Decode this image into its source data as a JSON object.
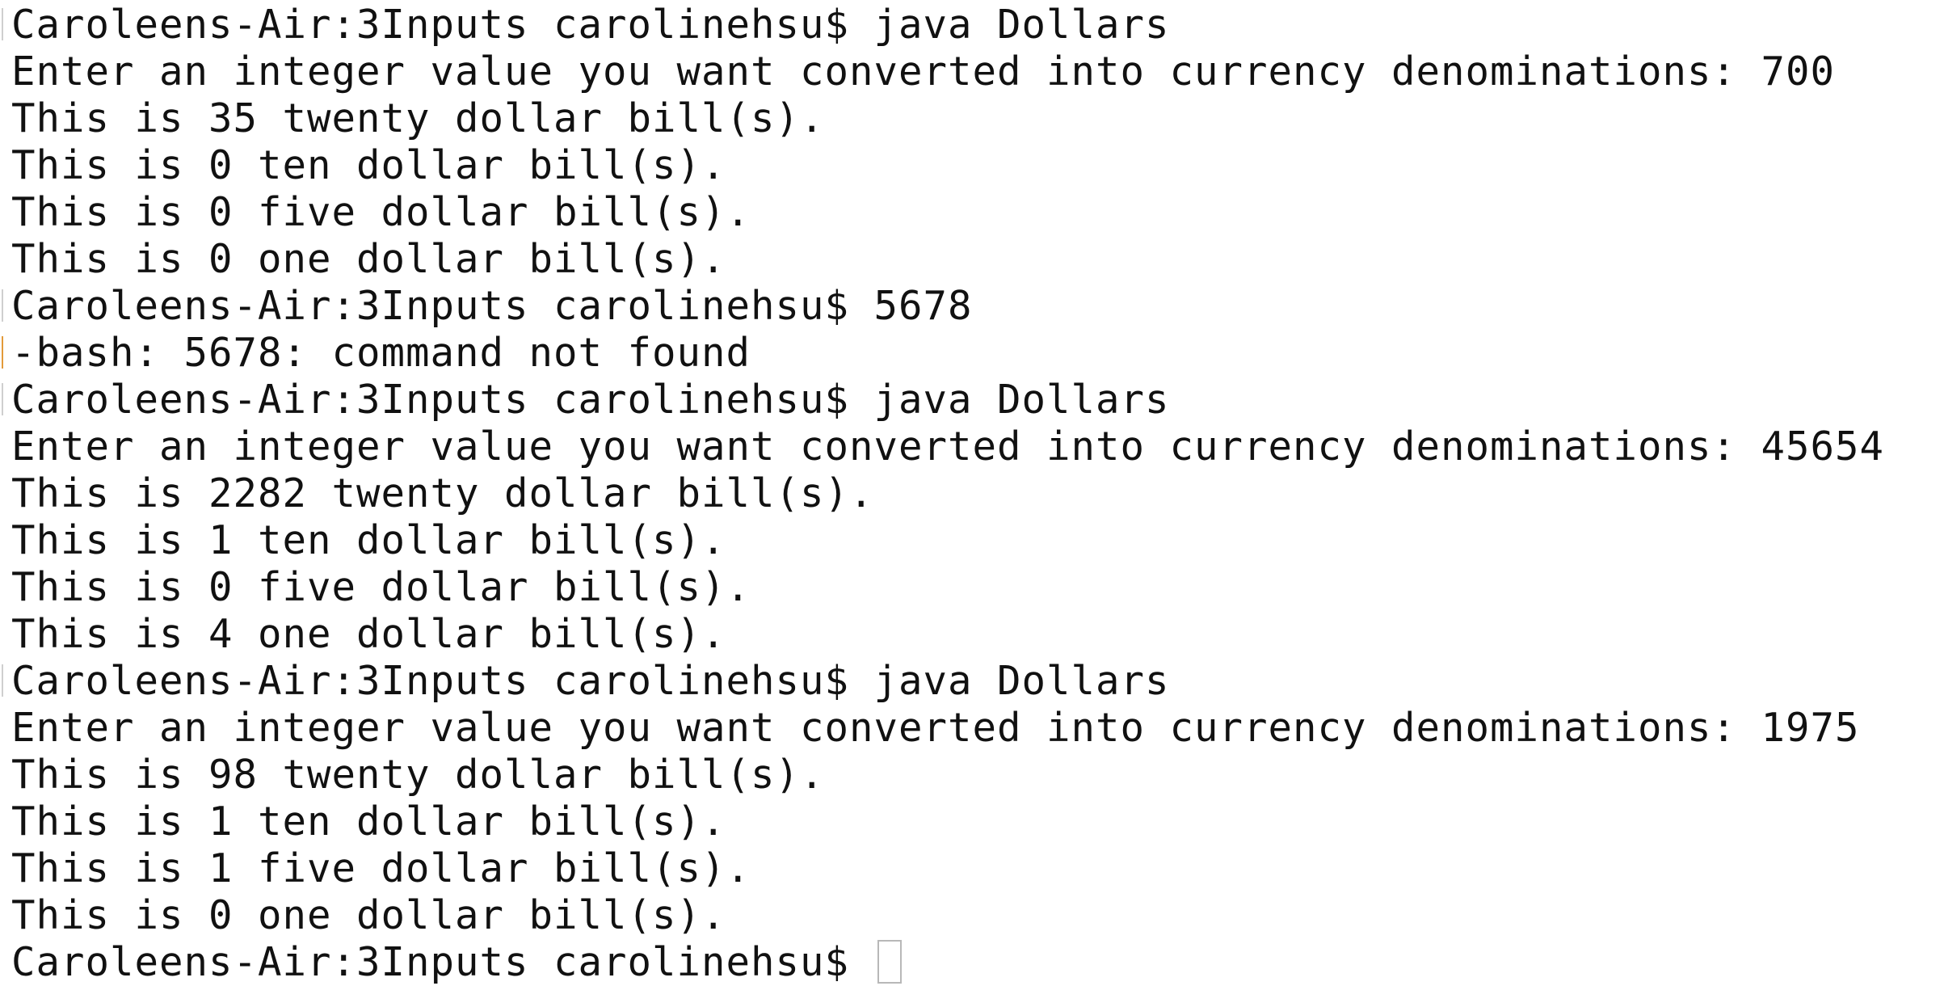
{
  "terminal": {
    "lines": [
      "Caroleens-Air:3Inputs carolinehsu$ java Dollars",
      "Enter an integer value you want converted into currency denominations: 700",
      "This is 35 twenty dollar bill(s).",
      "This is 0 ten dollar bill(s).",
      "This is 0 five dollar bill(s).",
      "This is 0 one dollar bill(s).",
      "Caroleens-Air:3Inputs carolinehsu$ 5678",
      "-bash: 5678: command not found",
      "Caroleens-Air:3Inputs carolinehsu$ java Dollars",
      "Enter an integer value you want converted into currency denominations: 45654",
      "This is 2282 twenty dollar bill(s).",
      "This is 1 ten dollar bill(s).",
      "This is 0 five dollar bill(s).",
      "This is 4 one dollar bill(s).",
      "Caroleens-Air:3Inputs carolinehsu$ java Dollars",
      "Enter an integer value you want converted into currency denominations: 1975",
      "This is 98 twenty dollar bill(s).",
      "This is 1 ten dollar bill(s).",
      "This is 1 five dollar bill(s).",
      "This is 0 one dollar bill(s).",
      "Caroleens-Air:3Inputs carolinehsu$ "
    ]
  }
}
